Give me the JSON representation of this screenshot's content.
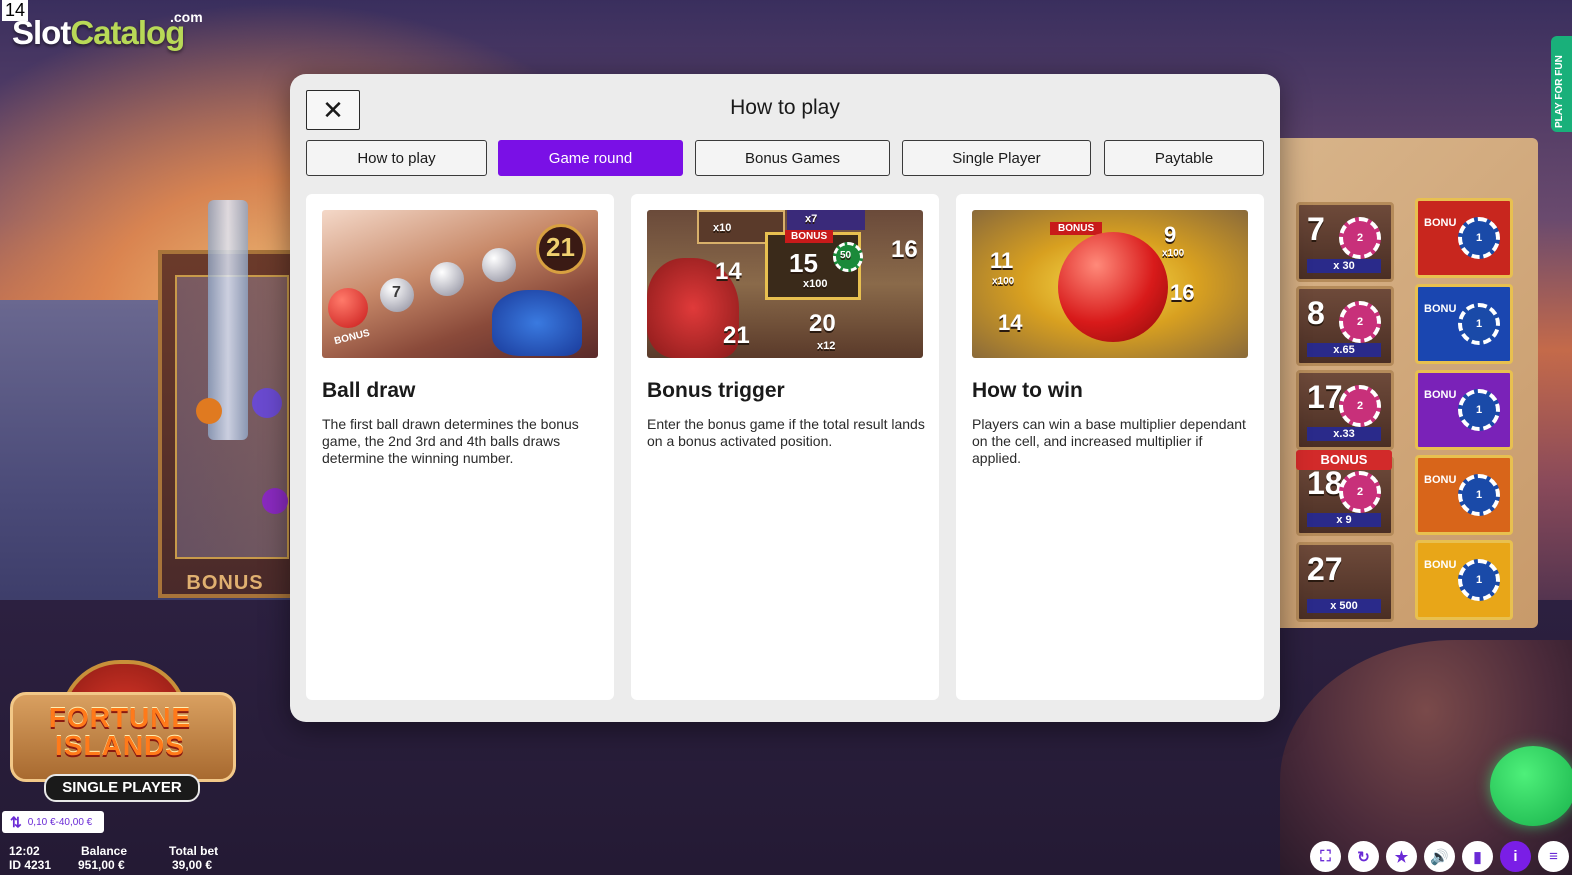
{
  "watermark": {
    "number": "14",
    "brand_slot": "Slot",
    "brand_catalog": "Catalog",
    "brand_com": ".com"
  },
  "side_tab": {
    "label": "PLAY FOR FUN"
  },
  "background": {
    "machine_label": "BONUS"
  },
  "board": {
    "cells": [
      {
        "number": "7",
        "chip": "2",
        "multiplier": "x 30"
      },
      {
        "number": "8",
        "chip": "2",
        "multiplier": "x.65"
      },
      {
        "number": "17",
        "chip": "2",
        "multiplier": "x.33"
      },
      {
        "number": "18",
        "chip": "2",
        "multiplier": "x 9"
      },
      {
        "number": "27",
        "chip": "",
        "multiplier": "x 500"
      }
    ],
    "bonus_ribbon": "BONUS",
    "bonus_cells": [
      {
        "label": "BONU",
        "chip": "1",
        "color": "#c8261e"
      },
      {
        "label": "BONU",
        "chip": "1",
        "color": "#1a46b0"
      },
      {
        "label": "BONU",
        "chip": "1",
        "color": "#7a22b8"
      },
      {
        "label": "BONU",
        "chip": "1",
        "color": "#d8651a"
      },
      {
        "label": "BONU",
        "chip": "1",
        "color": "#e8a618"
      }
    ]
  },
  "game_logo": {
    "line1": "FORTUNE",
    "line2": "ISLANDS",
    "badge": "SINGLE PLAYER"
  },
  "hud": {
    "bet_range": "0,10 €-40,00 €",
    "time": "12:02",
    "id": "ID 4231",
    "balance_label": "Balance",
    "balance_value": "951,00 €",
    "total_bet_label": "Total bet",
    "total_bet_value": "39,00 €",
    "buttons": [
      {
        "icon": "fullscreen-icon",
        "glyph": "⛶"
      },
      {
        "icon": "autoplay-icon",
        "glyph": "↻"
      },
      {
        "icon": "favorite-star-icon",
        "glyph": "★"
      },
      {
        "icon": "sound-icon",
        "glyph": "🔊"
      },
      {
        "icon": "stats-icon",
        "glyph": "▮"
      },
      {
        "icon": "info-icon",
        "glyph": "i"
      },
      {
        "icon": "menu-icon",
        "glyph": "≡"
      }
    ]
  },
  "modal": {
    "title": "How to play",
    "close_glyph": "✕",
    "tabs": [
      {
        "label": "How to play"
      },
      {
        "label": "Game round"
      },
      {
        "label": "Bonus Games"
      },
      {
        "label": "Single Player"
      },
      {
        "label": "Paytable"
      }
    ],
    "active_tab": "Game round",
    "cards": [
      {
        "title": "Ball draw",
        "text": "The first ball drawn determines the bonus game, the 2nd 3rd and 4th balls draws determine the winning number.",
        "image_labels": {
          "big_number": "21",
          "ball_number": "7",
          "bonus_tag": "BONUS"
        }
      },
      {
        "title": "Bonus trigger",
        "text": "Enter the bonus game if the total result lands on a bonus activated position.",
        "image_labels": {
          "n1": "14",
          "n2": "15",
          "n3": "16",
          "n4": "21",
          "n5": "20",
          "m1": "x10",
          "m2": "x100",
          "m3": "x12",
          "m4": "x7",
          "chip": "50",
          "bonus": "BONUS"
        }
      },
      {
        "title": "How to win",
        "text": "Players can win a base multiplier dependant on the cell, and increased multiplier if applied.",
        "image_labels": {
          "n1": "11",
          "n2": "14",
          "n3": "9",
          "n4": "16",
          "m1": "x100",
          "m2": "x100",
          "bonus": "BONUS"
        }
      }
    ]
  }
}
